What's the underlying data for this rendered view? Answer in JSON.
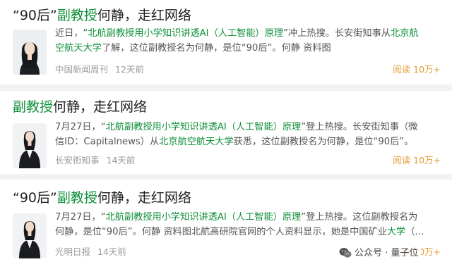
{
  "results": [
    {
      "title_parts": [
        {
          "text": "“90后”",
          "hl": false
        },
        {
          "text": "副教授",
          "hl": true
        },
        {
          "text": "何静，走红网络",
          "hl": false
        }
      ],
      "snippet_lines": [
        [
          {
            "text": "近日，“",
            "hl": false
          },
          {
            "text": "北航副教授用小学知识讲透AI（人工智能）原理",
            "hl": true
          },
          {
            "text": "”冲上热搜。长安街知事从",
            "hl": false
          },
          {
            "text": "北京航",
            "hl": true
          }
        ],
        [
          {
            "text": "空航天大学",
            "hl": true
          },
          {
            "text": "了解，这位副教授名为何静，是位“90后”。何静 资料图",
            "hl": false
          }
        ]
      ],
      "source": "中国新闻周刊",
      "time": "12天前",
      "reads": "阅读 10万+"
    },
    {
      "title_parts": [
        {
          "text": "副教授",
          "hl": true
        },
        {
          "text": "何静，走红网络",
          "hl": false
        }
      ],
      "snippet_lines": [
        [
          {
            "text": "7月27日，“",
            "hl": false
          },
          {
            "text": "北航副教授用小学知识讲透AI（人工智能）原理",
            "hl": true
          },
          {
            "text": "”登上热搜。长安街知事（微",
            "hl": false
          }
        ],
        [
          {
            "text": "信ID：Capitalnews）从",
            "hl": false
          },
          {
            "text": "北京航空航天大学",
            "hl": true
          },
          {
            "text": "获悉，这位副教授名为何静，是位“90后”。",
            "hl": false
          }
        ]
      ],
      "source": "长安街知事",
      "time": "14天前",
      "reads": "阅读 10万+"
    },
    {
      "title_parts": [
        {
          "text": "“90后”",
          "hl": false
        },
        {
          "text": "副教授",
          "hl": true
        },
        {
          "text": "何静，走红网络",
          "hl": false
        }
      ],
      "snippet_lines": [
        [
          {
            "text": "7月27日，“",
            "hl": false
          },
          {
            "text": "北航副教授用小学知识讲透AI（人工智能）原理",
            "hl": true
          },
          {
            "text": "”登上热搜。这位副教授名为",
            "hl": false
          }
        ],
        [
          {
            "text": "何静，是位“90后”。何静 资料图北航高研院官网的个人资料显示，她是中国矿业",
            "hl": false
          },
          {
            "text": "大学",
            "hl": true
          },
          {
            "text": "（…",
            "hl": false
          }
        ]
      ],
      "source": "光明日报",
      "time": "14天前",
      "reads": "阅读 10万+"
    }
  ],
  "watermark": {
    "text": "公众号 · 量子位",
    "icon": "wechat-icon"
  },
  "colors": {
    "highlight": "#0f8f3a",
    "reads": "#e39a32",
    "meta": "#9a9a9a",
    "background": "#f2f2f2"
  }
}
